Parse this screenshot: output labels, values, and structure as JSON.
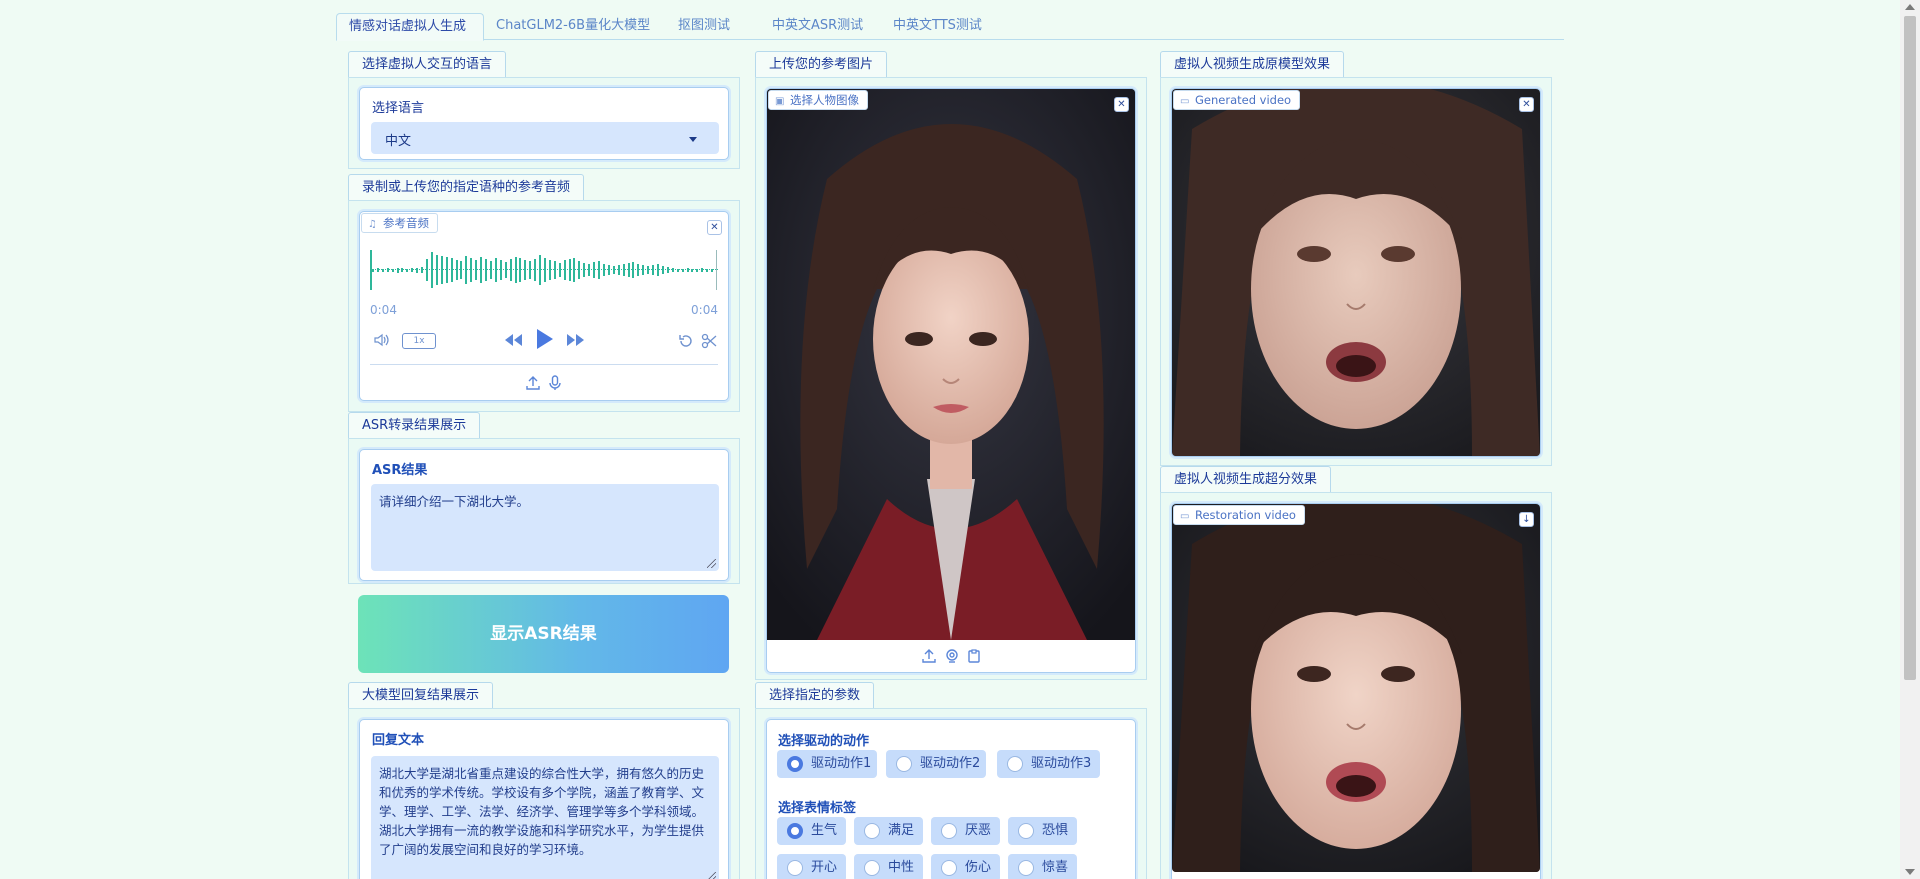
{
  "tabs": [
    {
      "label": "情感对话虚拟人生成",
      "active": true
    },
    {
      "label": "ChatGLM2-6B量化大模型",
      "active": false
    },
    {
      "label": "抠图测试",
      "active": false
    },
    {
      "label": "中英文ASR测试",
      "active": false
    },
    {
      "label": "中英文TTS测试",
      "active": false
    }
  ],
  "left": {
    "language_section": {
      "title": "选择虚拟人交互的语言",
      "label": "选择语言",
      "value": "中文"
    },
    "audio_section": {
      "title": "录制或上传您的指定语种的参考音频",
      "badge": "参考音频",
      "time_current": "0:04",
      "time_total": "0:04",
      "speed": "1x"
    },
    "asr_section": {
      "title": "ASR转录结果展示",
      "label": "ASR结果",
      "text": "请详细介绍一下湖北大学。"
    },
    "asr_button": "显示ASR结果",
    "llm_section": {
      "title": "大模型回复结果展示",
      "label": "回复文本",
      "text": "湖北大学是湖北省重点建设的综合性大学，拥有悠久的历史和优秀的学术传统。学校设有多个学院，涵盖了教育学、文学、理学、工学、法学、经济学、管理学等多个学科领域。湖北大学拥有一流的教学设施和科学研究水平，为学生提供了广阔的发展空间和良好的学习环境。"
    }
  },
  "middle": {
    "image_section": {
      "title": "上传您的参考图片",
      "badge": "选择人物图像"
    },
    "params_section": {
      "title": "选择指定的参数",
      "motion_label": "选择驱动的动作",
      "motions": [
        {
          "label": "驱动动作1",
          "checked": true
        },
        {
          "label": "驱动动作2",
          "checked": false
        },
        {
          "label": "驱动动作3",
          "checked": false
        }
      ],
      "emotion_label": "选择表情标签",
      "emotions": [
        {
          "label": "生气",
          "checked": true
        },
        {
          "label": "满足",
          "checked": false
        },
        {
          "label": "厌恶",
          "checked": false
        },
        {
          "label": "恐惧",
          "checked": false
        },
        {
          "label": "开心",
          "checked": false
        },
        {
          "label": "中性",
          "checked": false
        },
        {
          "label": "伤心",
          "checked": false
        },
        {
          "label": "惊喜",
          "checked": false
        }
      ]
    }
  },
  "right": {
    "original_section": {
      "title": "虚拟人视频生成原模型效果",
      "badge": "Generated video"
    },
    "sr_section": {
      "title": "虚拟人视频生成超分效果",
      "badge": "Restoration video"
    }
  },
  "colors": {
    "background": "#effbf4",
    "accent": "#4a79e0",
    "waveform": "#2eb79a",
    "input_bg": "#d6e6fd"
  }
}
